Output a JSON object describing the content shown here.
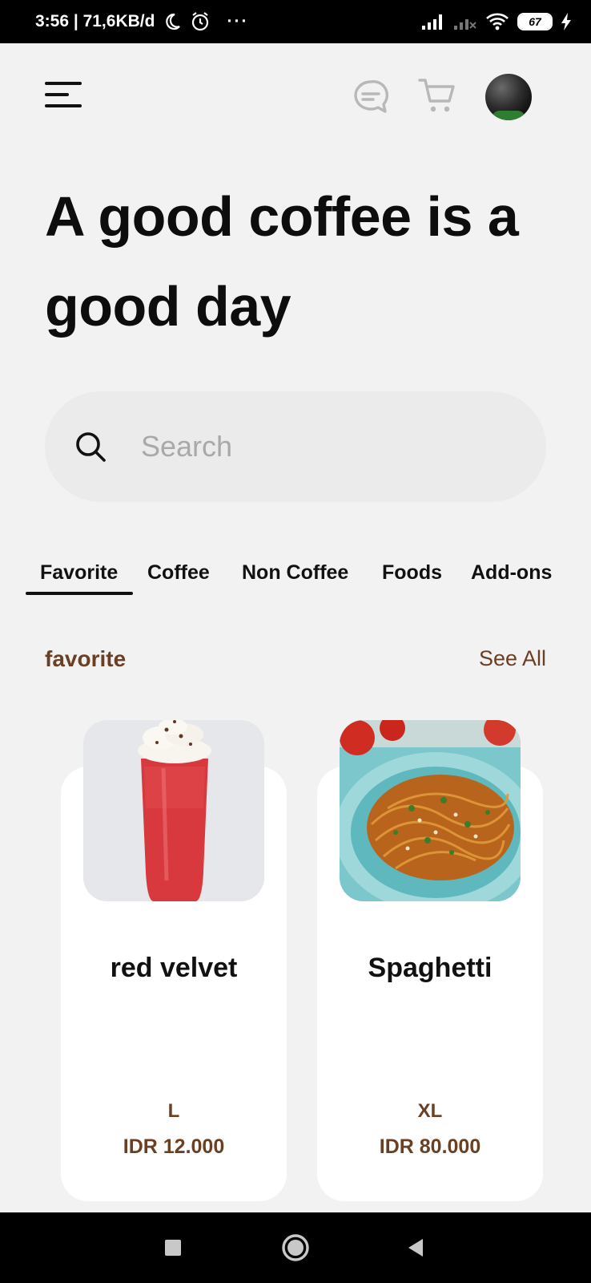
{
  "status_bar": {
    "time_and_speed": "3:56 | 71,6KB/d",
    "dots": "···",
    "battery": "67"
  },
  "header": {
    "menu_icon": "hamburger-menu-icon",
    "chat_icon": "chat-bubble-icon",
    "cart_icon": "shopping-cart-icon",
    "avatar": "user-avatar"
  },
  "headline": "A good coffee is a good day",
  "search": {
    "placeholder": "Search",
    "icon": "search-icon"
  },
  "tabs": [
    {
      "label": "Favorite",
      "active": true
    },
    {
      "label": "Coffee",
      "active": false
    },
    {
      "label": "Non Coffee",
      "active": false
    },
    {
      "label": "Foods",
      "active": false
    },
    {
      "label": "Add-ons",
      "active": false
    }
  ],
  "section": {
    "title": "favorite",
    "see_all": "See All"
  },
  "products": [
    {
      "name": "red velvet",
      "size": "L",
      "price": "IDR 12.000",
      "image": "red-velvet-drink"
    },
    {
      "name": "Spaghetti",
      "size": "XL",
      "price": "IDR 80.000",
      "image": "spaghetti-plate"
    }
  ],
  "colors": {
    "accent_brown": "#6b3f22",
    "background": "#f2f2f2",
    "card": "#ffffff"
  }
}
